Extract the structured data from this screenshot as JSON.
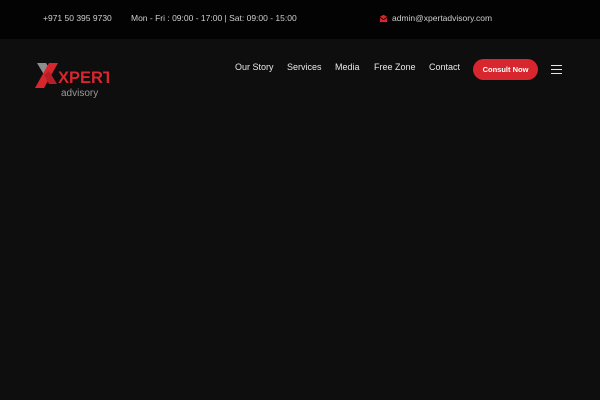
{
  "topbar": {
    "phone": "+971 50 395 9730",
    "hours": "Mon - Fri : 09:00 - 17:00 | Sat: 09:00 - 15:00",
    "email": "admin@xpertadvisory.com",
    "email_icon": "envelope-icon"
  },
  "logo": {
    "text_main": "XPERT",
    "text_sub": "advisory"
  },
  "nav": {
    "items": [
      {
        "label": "Our Story"
      },
      {
        "label": "Services"
      },
      {
        "label": "Media"
      },
      {
        "label": "Free Zone"
      },
      {
        "label": "Contact"
      }
    ]
  },
  "cta": {
    "label": "Consult Now"
  },
  "colors": {
    "accent": "#d7262d",
    "topbar_bg": "#030303",
    "page_bg": "#0e0e0e",
    "text_light": "#e8e8e8"
  },
  "icons": {
    "menu": "hamburger-menu-icon"
  }
}
